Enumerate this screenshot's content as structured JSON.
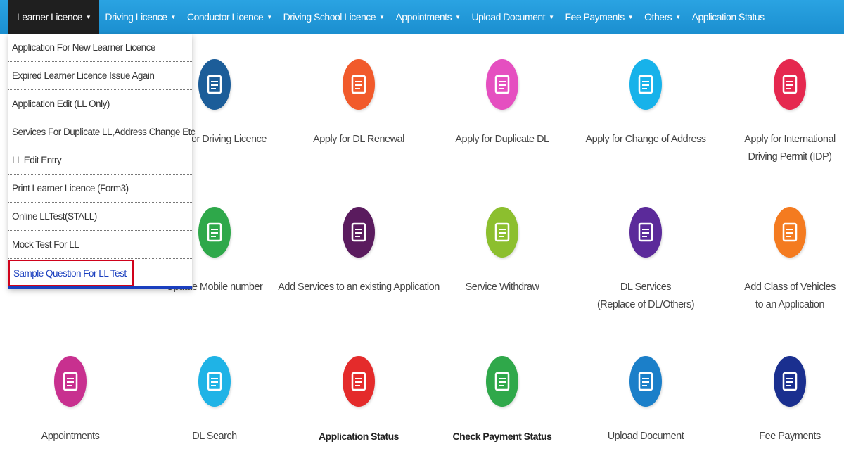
{
  "nav": {
    "items": [
      {
        "label": "Learner Licence",
        "caret": true,
        "active": true
      },
      {
        "label": "Driving Licence",
        "caret": true
      },
      {
        "label": "Conductor Licence",
        "caret": true
      },
      {
        "label": "Driving School Licence",
        "caret": true
      },
      {
        "label": "Appointments",
        "caret": true
      },
      {
        "label": "Upload Document",
        "caret": true
      },
      {
        "label": "Fee Payments",
        "caret": true
      },
      {
        "label": "Others",
        "caret": true
      },
      {
        "label": "Application Status",
        "caret": false
      }
    ]
  },
  "dropdown": {
    "items": [
      "Application For New Learner Licence",
      "Expired Learner Licence Issue Again",
      "Application Edit (LL Only)",
      "Services For Duplicate LL,Address Change Etc",
      "LL Edit Entry",
      "Print Learner Licence (Form3)",
      "Online LLTest(STALL)",
      "Mock Test For LL",
      "Sample Question For LL Test"
    ],
    "highlighted": "Sample Question For LL Test"
  },
  "tiles": [
    {
      "label": "Apply for Driving Licence",
      "icon": "id-card-icon",
      "color": "#1c5d99"
    },
    {
      "label": "Apply for DL Renewal",
      "icon": "document-icon",
      "color": "#f15a2b"
    },
    {
      "label": "Apply for Duplicate DL",
      "icon": "car-card-icon",
      "color": "#e54fc0"
    },
    {
      "label": "Apply for Change of Address",
      "icon": "printer-icon",
      "color": "#17b2ea"
    },
    {
      "label": "Apply for International\nDriving Permit (IDP)",
      "icon": "person-icon",
      "color": "#e5284f"
    },
    {
      "label": "Update Mobile number",
      "icon": "mobile-info-icon",
      "color": "#2ea84a"
    },
    {
      "label": "Add Services to an existing Application",
      "icon": "card-arrow-icon",
      "color": "#5a1b5e"
    },
    {
      "label": "Service Withdraw",
      "icon": "upload-tray-icon",
      "color": "#8cbf2e"
    },
    {
      "label": "DL Services\n(Replace of DL/Others)",
      "icon": "profile-card-icon",
      "color": "#5b2a9a"
    },
    {
      "label": "Add Class of Vehicles\nto an Application",
      "icon": "checklist-icon",
      "color": "#f47b20"
    },
    {
      "label": "Appointments",
      "icon": "calendar-icon",
      "color": "#c8308f"
    },
    {
      "label": "DL Search",
      "icon": "search-person-icon",
      "color": "#1fb3e6"
    },
    {
      "label": "Application Status",
      "icon": "clipboard-chart-icon",
      "color": "#e42b2b",
      "bold": true
    },
    {
      "label": "Check Payment Status",
      "icon": "payment-card-icon",
      "color": "#2fa84a",
      "bold": true
    },
    {
      "label": "Upload Document",
      "icon": "upload-icon",
      "color": "#1b7fc9"
    },
    {
      "label": "Fee Payments",
      "icon": "hand-coin-icon",
      "color": "#1a2f8f"
    }
  ]
}
